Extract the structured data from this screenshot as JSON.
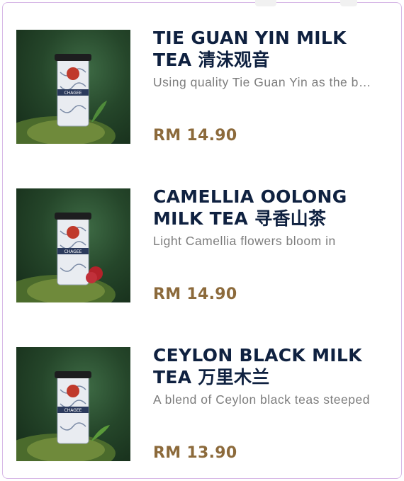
{
  "products": [
    {
      "name": "TIE GUAN YIN MILK TEA 清沫观音",
      "description": "Using quality Tie Guan Yin as the base",
      "price": "RM 14.90",
      "accent": "#4f8b3a"
    },
    {
      "name": "CAMELLIA OOLONG MILK TEA 寻香山茶",
      "description": "Light Camellia flowers bloom in",
      "price": "RM 14.90",
      "accent": "#b3222a"
    },
    {
      "name": "CEYLON BLACK MILK TEA 万里木兰",
      "description": "A blend of Ceylon black teas steeped",
      "price": "RM 13.90",
      "accent": "#5a9a3a"
    }
  ],
  "cup_label": "CHAGEE"
}
